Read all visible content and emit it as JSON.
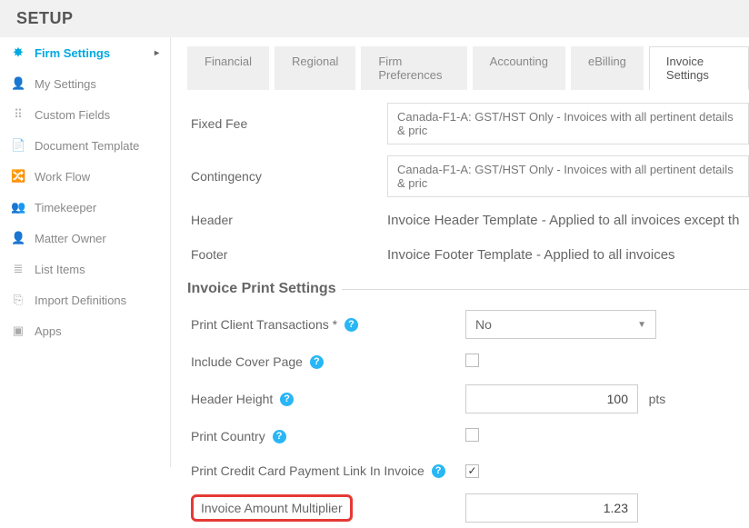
{
  "pageTitle": "SETUP",
  "sidebar": {
    "items": [
      {
        "label": "Firm Settings",
        "icon": "✸",
        "active": true,
        "hasSub": true
      },
      {
        "label": "My Settings",
        "icon": "👤"
      },
      {
        "label": "Custom Fields",
        "icon": "⠿"
      },
      {
        "label": "Document Template",
        "icon": "📄"
      },
      {
        "label": "Work Flow",
        "icon": "🔀"
      },
      {
        "label": "Timekeeper",
        "icon": "👥"
      },
      {
        "label": "Matter Owner",
        "icon": "👤"
      },
      {
        "label": "List Items",
        "icon": "≣"
      },
      {
        "label": "Import Definitions",
        "icon": "⎘"
      },
      {
        "label": "Apps",
        "icon": "▣"
      }
    ]
  },
  "tabs": [
    {
      "label": "Financial"
    },
    {
      "label": "Regional"
    },
    {
      "label": "Firm Preferences"
    },
    {
      "label": "Accounting"
    },
    {
      "label": "eBilling"
    },
    {
      "label": "Invoice Settings",
      "active": true
    }
  ],
  "templateRows": {
    "fixedFee": {
      "label": "Fixed Fee",
      "value": "Canada-F1-A: GST/HST Only - Invoices with all pertinent details & pric"
    },
    "contingency": {
      "label": "Contingency",
      "value": "Canada-F1-A: GST/HST Only - Invoices with all pertinent details & pric"
    },
    "header": {
      "label": "Header",
      "value": "Invoice Header Template - Applied to all invoices except th"
    },
    "footer": {
      "label": "Footer",
      "value": "Invoice Footer Template - Applied to all invoices"
    }
  },
  "printSection": {
    "legend": "Invoice Print Settings",
    "rows": {
      "printClientTransactions": {
        "label": "Print Client Transactions *",
        "value": "No"
      },
      "includeCoverPage": {
        "label": "Include Cover Page",
        "checked": false
      },
      "headerHeight": {
        "label": "Header Height",
        "value": "100",
        "unit": "pts"
      },
      "printCountry": {
        "label": "Print Country",
        "checked": false
      },
      "printCCLink": {
        "label": "Print Credit Card Payment Link In Invoice",
        "checked": true
      },
      "invoiceAmountMultiplier": {
        "label": "Invoice Amount Multiplier",
        "value": "1.23"
      }
    }
  }
}
